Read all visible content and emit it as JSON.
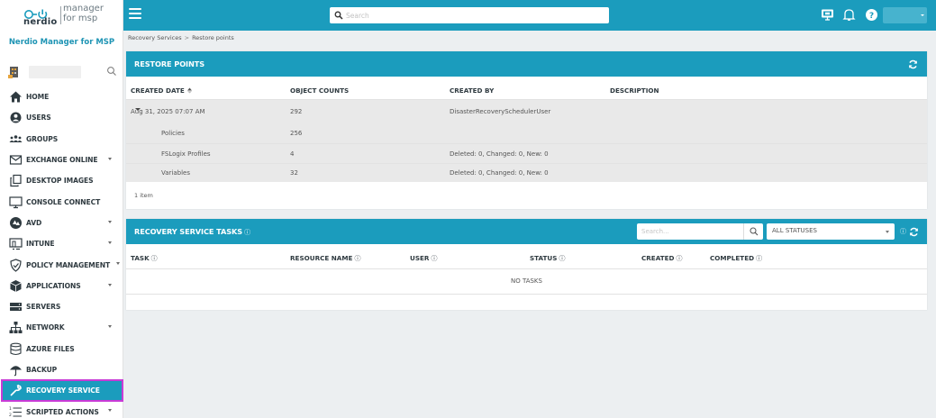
{
  "sidebar": {
    "logo_top": "manager",
    "logo_bottom": "for msp",
    "logo_nerdio": "nerdio",
    "subtitle": "Nerdio Manager for MSP",
    "items": [
      {
        "label": "HOME",
        "icon": "home-icon",
        "caret": false
      },
      {
        "label": "USERS",
        "icon": "user-icon",
        "caret": false
      },
      {
        "label": "GROUPS",
        "icon": "groups-icon",
        "caret": false
      },
      {
        "label": "EXCHANGE ONLINE",
        "icon": "envelope-icon",
        "caret": true
      },
      {
        "label": "DESKTOP IMAGES",
        "icon": "copy-icon",
        "caret": false
      },
      {
        "label": "CONSOLE CONNECT",
        "icon": "monitor-icon",
        "caret": false
      },
      {
        "label": "AVD",
        "icon": "avd-icon",
        "caret": true
      },
      {
        "label": "INTUNE",
        "icon": "intune-icon",
        "caret": true
      },
      {
        "label": "POLICY MANAGEMENT",
        "icon": "shield-check-icon",
        "caret": true
      },
      {
        "label": "APPLICATIONS",
        "icon": "box-icon",
        "caret": true
      },
      {
        "label": "SERVERS",
        "icon": "server-icon",
        "caret": false
      },
      {
        "label": "NETWORK",
        "icon": "network-icon",
        "caret": true
      },
      {
        "label": "AZURE FILES",
        "icon": "database-icon",
        "caret": false
      },
      {
        "label": "BACKUP",
        "icon": "umbrella-icon",
        "caret": false
      },
      {
        "label": "RECOVERY SERVICE",
        "icon": "wrench-icon",
        "caret": false,
        "active": true
      },
      {
        "label": "SCRIPTED ACTIONS",
        "icon": "list-ordered-icon",
        "caret": true
      }
    ]
  },
  "topbar": {
    "search_placeholder": "Search"
  },
  "breadcrumb": {
    "parent": "Recovery Services",
    "separator": ">",
    "current": "Restore points"
  },
  "restore_points": {
    "title": "RESTORE POINTS",
    "columns": [
      "CREATED DATE",
      "OBJECT COUNTS",
      "CREATED BY",
      "DESCRIPTION"
    ],
    "main_row": {
      "date": "Aug 31, 2025 07:07 AM",
      "count": "292",
      "created_by": "DisasterRecoverySchedulerUser",
      "description": ""
    },
    "sub_rows": [
      {
        "name": "Policies",
        "count": "256",
        "detail": ""
      },
      {
        "name": "FSLogix Profiles",
        "count": "4",
        "detail": "Deleted: 0, Changed: 0, New: 0"
      },
      {
        "name": "Variables",
        "count": "32",
        "detail": "Deleted: 0, Changed: 0, New: 0"
      }
    ],
    "item_count": "1 item"
  },
  "recovery_tasks": {
    "title": "RECOVERY SERVICE TASKS",
    "search_placeholder": "Search...",
    "status_filter": "ALL STATUSES",
    "columns": [
      "TASK",
      "RESOURCE NAME",
      "USER",
      "STATUS",
      "CREATED",
      "COMPLETED"
    ],
    "empty_text": "NO TASKS"
  },
  "colors": {
    "accent": "#1b9cbd",
    "active_outline": "#c93bd6",
    "brand_sub": "#1e94b4"
  }
}
